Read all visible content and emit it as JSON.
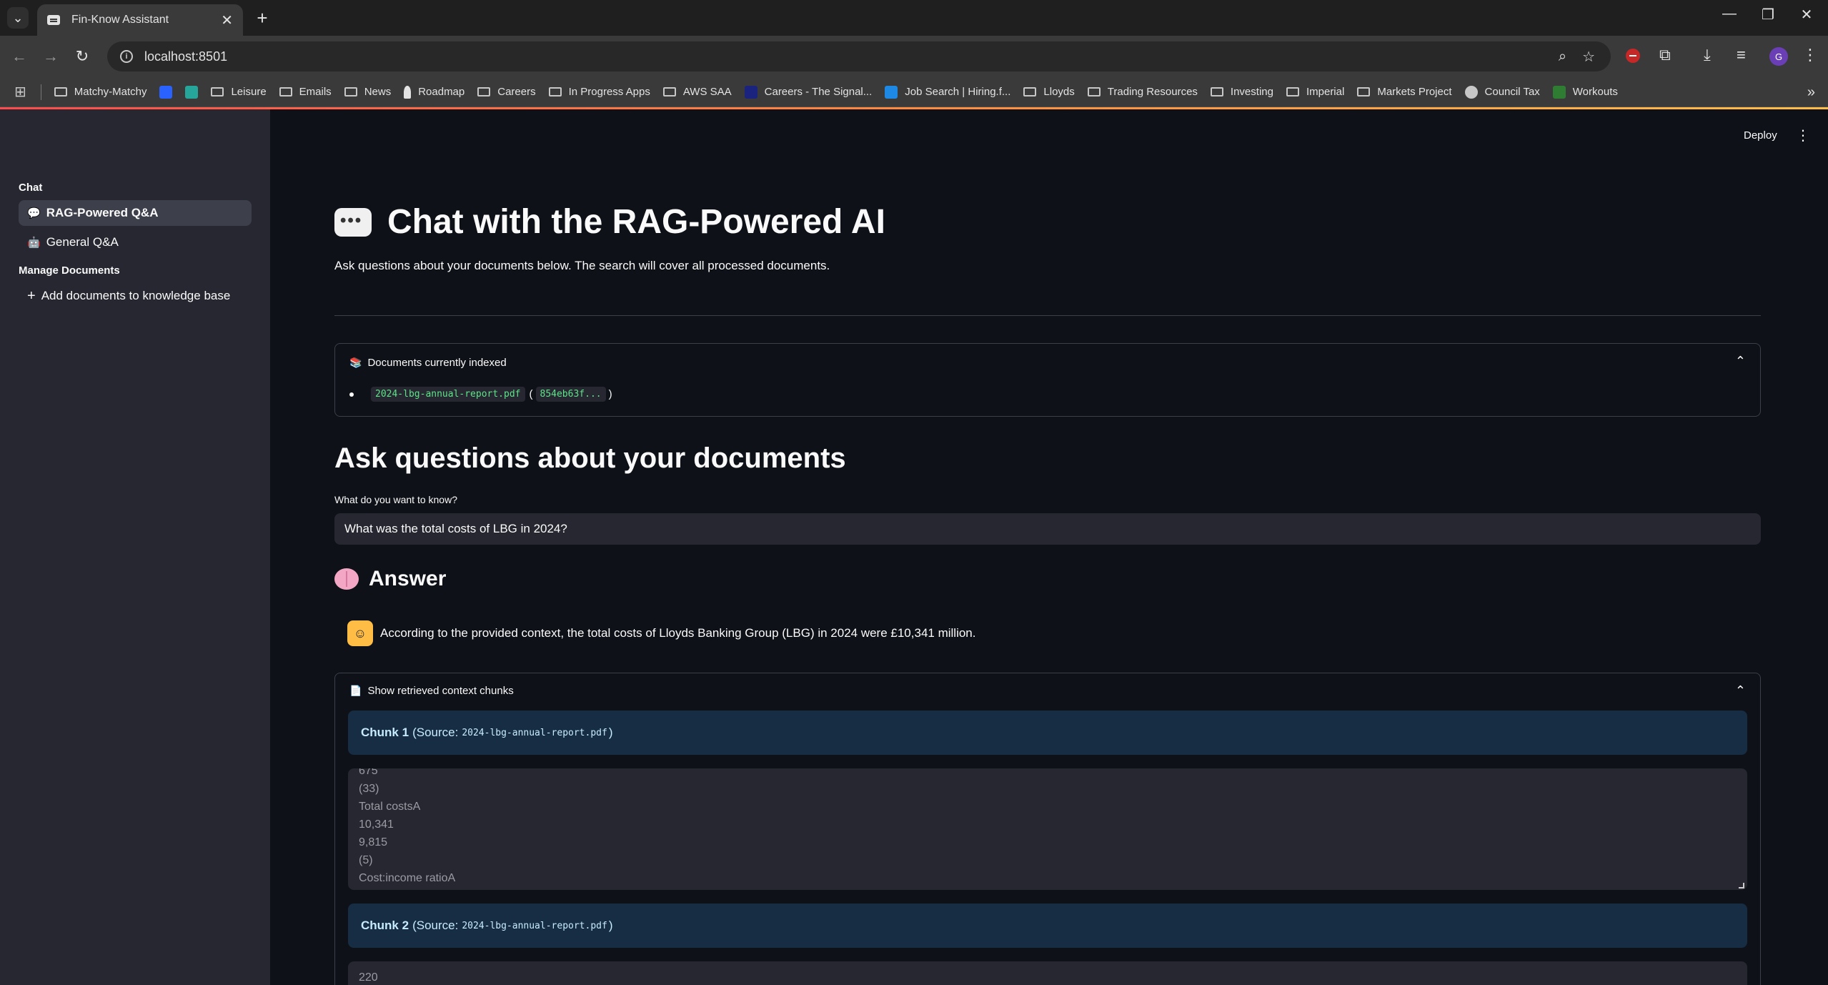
{
  "browser": {
    "tab_title": "Fin-Know Assistant",
    "url": "localhost:8501",
    "avatar_letter": "G",
    "bookmarks": [
      {
        "label": "Matchy-Matchy",
        "kind": "folder"
      },
      {
        "label": "",
        "kind": "app",
        "color": "#2962ff"
      },
      {
        "label": "",
        "kind": "app",
        "color": "#26a69a"
      },
      {
        "label": "Leisure",
        "kind": "folder"
      },
      {
        "label": "Emails",
        "kind": "folder"
      },
      {
        "label": "News",
        "kind": "folder"
      },
      {
        "label": "Roadmap",
        "kind": "pin"
      },
      {
        "label": "Careers",
        "kind": "folder"
      },
      {
        "label": "In Progress Apps",
        "kind": "folder"
      },
      {
        "label": "AWS SAA",
        "kind": "folder"
      },
      {
        "label": "Careers - The Signal...",
        "kind": "app",
        "color": "#1a237e"
      },
      {
        "label": "Job Search | Hiring.f...",
        "kind": "app",
        "color": "#1e88e5"
      },
      {
        "label": "Lloyds",
        "kind": "folder"
      },
      {
        "label": "Trading Resources",
        "kind": "folder"
      },
      {
        "label": "Investing",
        "kind": "folder"
      },
      {
        "label": "Imperial",
        "kind": "folder"
      },
      {
        "label": "Markets Project",
        "kind": "folder"
      },
      {
        "label": "Council Tax",
        "kind": "globe"
      },
      {
        "label": "Workouts",
        "kind": "app",
        "color": "#2e7d32"
      }
    ]
  },
  "sidebar": {
    "section_chat": "Chat",
    "item_rag": "RAG-Powered Q&A",
    "item_general": "General Q&A",
    "section_manage": "Manage Documents",
    "item_add": "Add documents to knowledge base"
  },
  "header": {
    "deploy": "Deploy"
  },
  "main": {
    "title": "Chat with the RAG-Powered AI",
    "intro": "Ask questions about your documents below. The search will cover all processed documents.",
    "indexed": {
      "label": "Documents currently indexed",
      "doc_name": "2024-lbg-annual-report.pdf",
      "doc_id": "854eb63f..."
    },
    "ask_heading": "Ask questions about your documents",
    "question_label": "What do you want to know?",
    "question_value": "What was the total costs of LBG in 2024?",
    "answer_heading": "Answer",
    "answer_text": "According to the provided context, the total costs of Lloyds Banking Group (LBG) in 2024 were £10,341 million.",
    "chunks_label": "Show retrieved context chunks",
    "chunks": [
      {
        "title": "Chunk 1",
        "source_prefix": "(Source:",
        "source": "2024-lbg-annual-report.pdf",
        "source_suffix": ")",
        "lines": [
          "675",
          "(33)",
          "Total costsA",
          "10,341",
          "9,815",
          "(5)",
          "Cost:income ratioA"
        ]
      },
      {
        "title": "Chunk 2",
        "source_prefix": "(Source:",
        "source": "2024-lbg-annual-report.pdf",
        "source_suffix": ")",
        "lines": [
          "220"
        ]
      }
    ]
  }
}
